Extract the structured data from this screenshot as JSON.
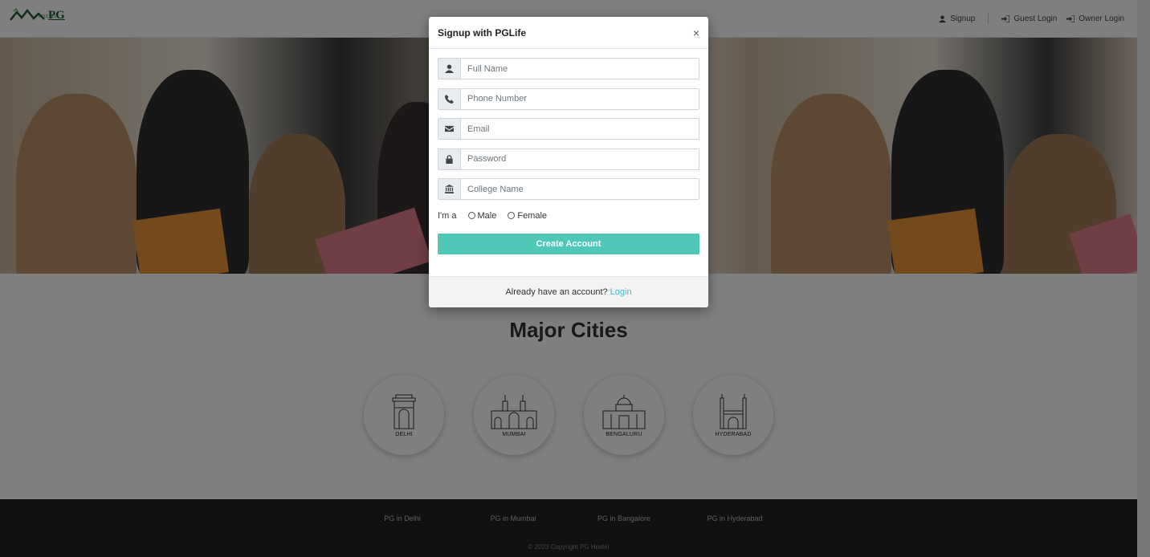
{
  "header": {
    "logo_text": "PG",
    "logo_sub": "HOSTEL",
    "nav": {
      "signup": "Signup",
      "guest_login": "Guest Login",
      "owner_login": "Owner Login"
    }
  },
  "main": {
    "cities_title": "Major Cities",
    "cities": [
      {
        "label": "DELHI",
        "icon": "india-gate-icon"
      },
      {
        "label": "MUMBAI",
        "icon": "gateway-of-india-icon"
      },
      {
        "label": "BENGALURU",
        "icon": "vidhana-soudha-icon"
      },
      {
        "label": "HYDERABAD",
        "icon": "charminar-icon"
      }
    ]
  },
  "footer": {
    "links": [
      "PG in Delhi",
      "PG in Mumbai",
      "PG in Bangalore",
      "PG in Hyderabad"
    ],
    "copyright": "© 2023 Copyright PG Hostel"
  },
  "modal": {
    "title": "Signup with PGLife",
    "close": "×",
    "fields": [
      {
        "placeholder": "Full Name",
        "icon": "user-icon"
      },
      {
        "placeholder": "Phone Number",
        "icon": "phone-icon"
      },
      {
        "placeholder": "Email",
        "icon": "envelope-icon"
      },
      {
        "placeholder": "Password",
        "icon": "lock-icon"
      },
      {
        "placeholder": "College Name",
        "icon": "university-icon"
      }
    ],
    "gender_label": "I'm a",
    "gender_options": [
      "Male",
      "Female"
    ],
    "create_button": "Create Account",
    "footer_text": "Already have an account?",
    "login_link": "Login"
  },
  "colors": {
    "accent": "#4fc8b7",
    "link": "#3fb7d6",
    "footer_bg": "#222222"
  }
}
